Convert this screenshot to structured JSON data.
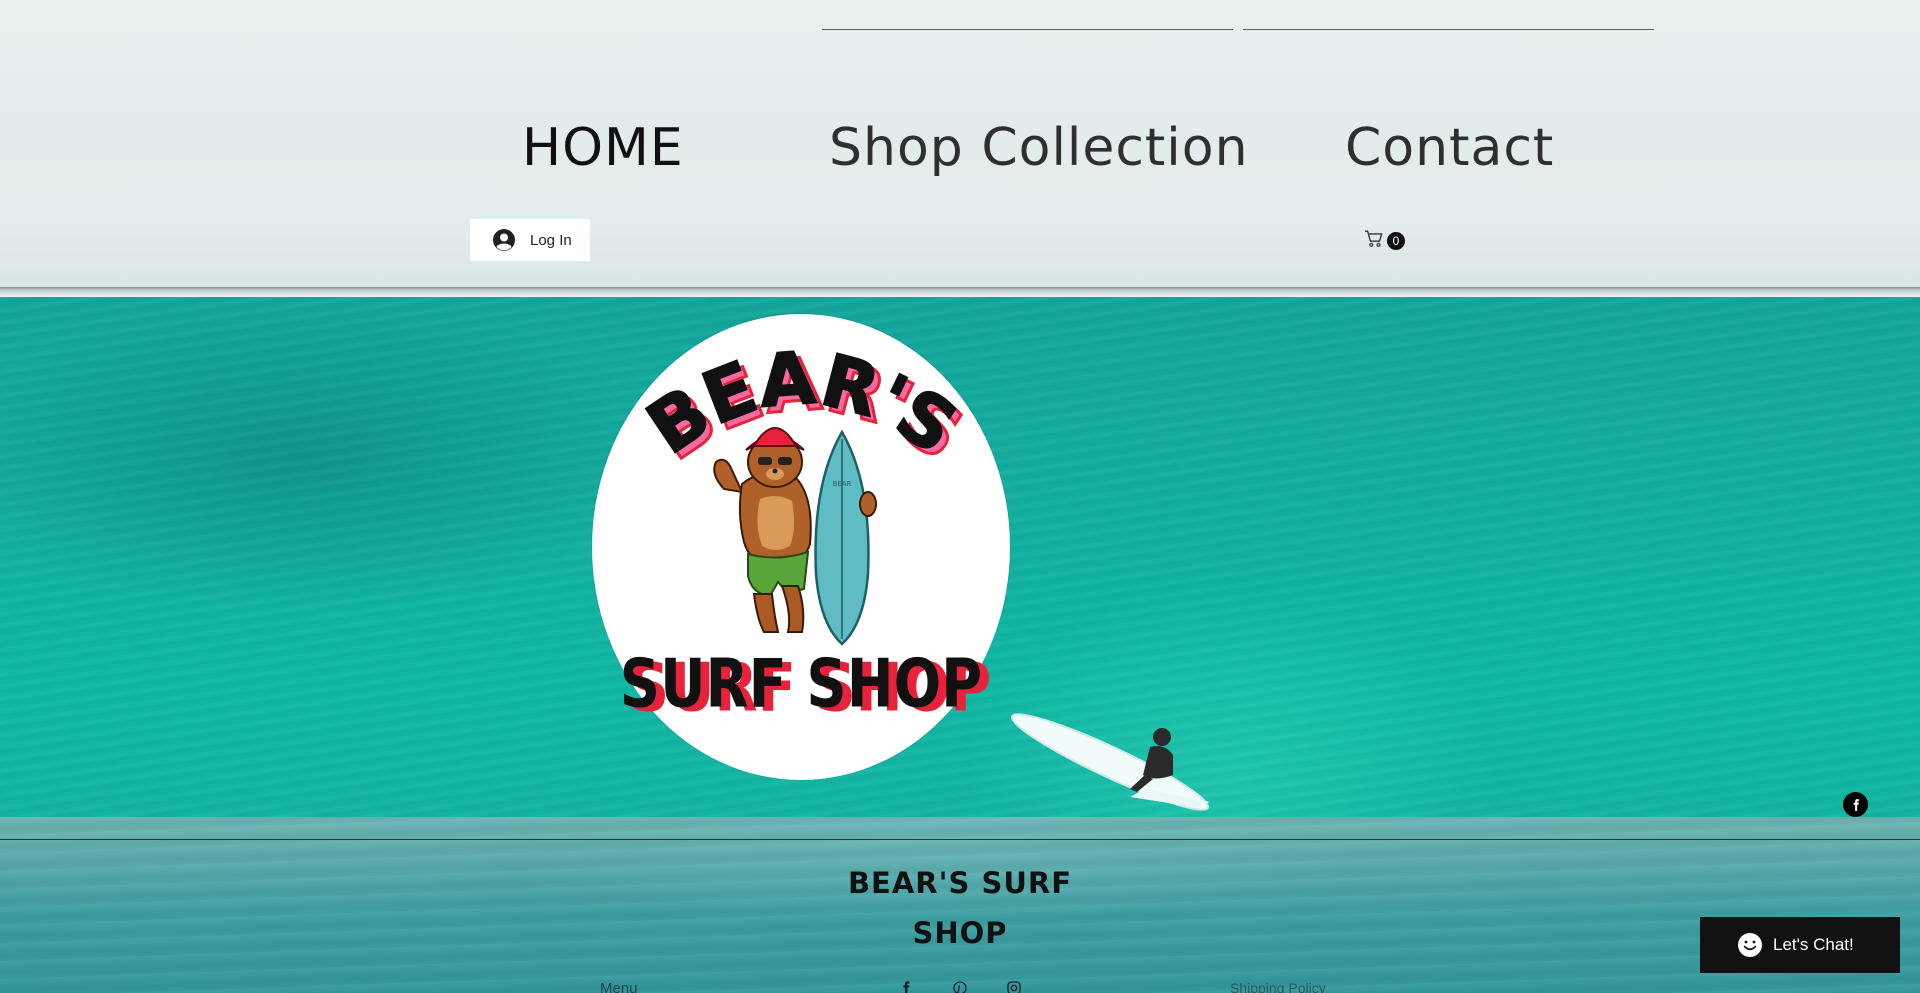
{
  "nav": {
    "items": [
      {
        "label": "HOME",
        "active": true
      },
      {
        "label": "Shop Collection",
        "active": false
      },
      {
        "label": "Contact",
        "active": false
      }
    ]
  },
  "login": {
    "label": "Log In",
    "icon": "user-avatar-icon"
  },
  "cart": {
    "count": "0",
    "icon": "cart-icon"
  },
  "logo": {
    "top_text": "BEAR'S",
    "bottom_text": "SURF SHOP",
    "board_text": "BEAR"
  },
  "social": [
    "facebook-icon",
    "pinterest-icon",
    "instagram-icon"
  ],
  "footer": {
    "title_line1": "BEAR'S SURF",
    "title_line2": "SHOP",
    "menu_label": "Menu",
    "policy_label": "Shipping Policy"
  },
  "chat": {
    "label": "Let's Chat!",
    "icon": "smiley-chat-icon"
  },
  "colors": {
    "accent_teal": "#12b0a0",
    "logo_red": "#e8223a",
    "logo_pink": "#f36ba0",
    "chat_bg": "#111111"
  }
}
